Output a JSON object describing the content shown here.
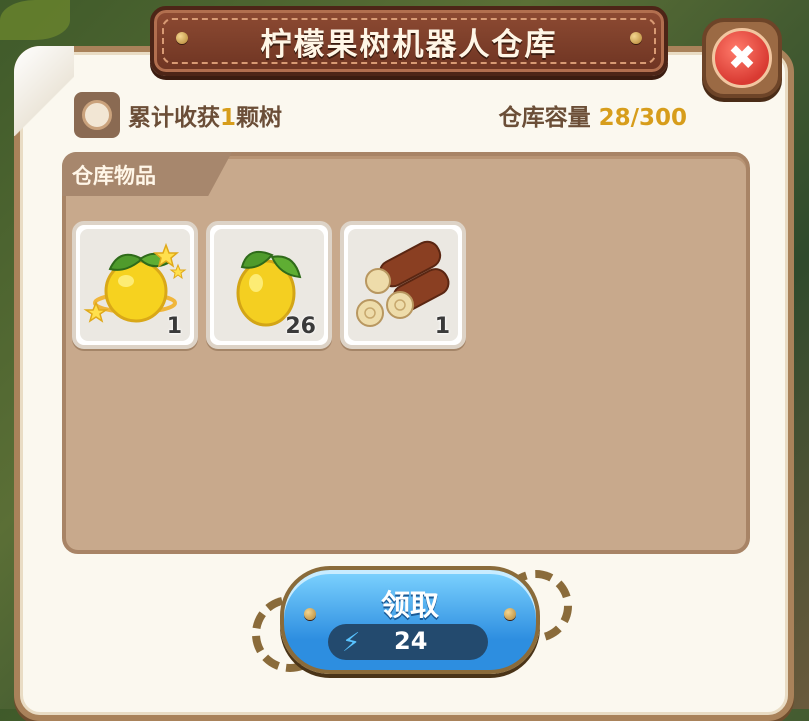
{
  "title": "柠檬果树机器人仓库",
  "header": {
    "harvest_prefix": "累计收获",
    "harvest_count": "1",
    "harvest_suffix": "颗树",
    "capacity_label": "仓库容量",
    "capacity_value": "28/300"
  },
  "inventory": {
    "tab_label": "仓库物品",
    "items": [
      {
        "icon": "golden-lemon-icon",
        "count": "1"
      },
      {
        "icon": "lemon-icon",
        "count": "26"
      },
      {
        "icon": "wood-logs-icon",
        "count": "1"
      }
    ]
  },
  "claim": {
    "label": "领取",
    "cost_icon": "lightning-bolt-icon",
    "cost": "24"
  },
  "colors": {
    "accent_gold": "#d79d1b",
    "banner_brown": "#8e4b33",
    "button_blue": "#2d8ee0",
    "close_red": "#d93a32"
  }
}
